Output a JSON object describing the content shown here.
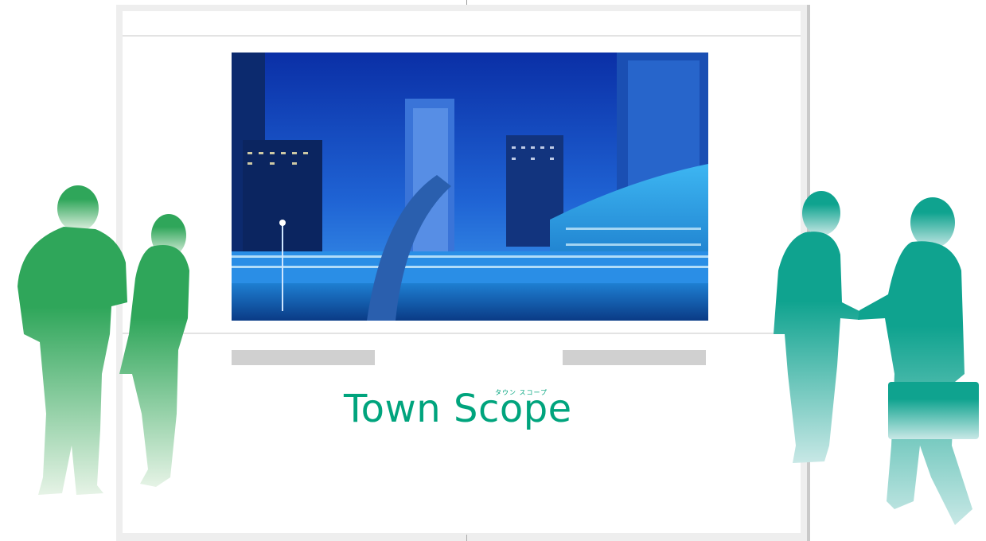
{
  "brand": {
    "name": "Town Scope",
    "kana": "タウン スコープ",
    "color": "#00a47d"
  },
  "illustration": {
    "photo": "night-city-skyscrapers",
    "left_figures": "couple-talking-silhouette",
    "right_figures": "businessmen-handshake-silhouette",
    "left_gradient": [
      "#2fa65a",
      "#e6f3e6"
    ],
    "right_gradient": [
      "#0fa38f",
      "#c8e8e6"
    ]
  }
}
